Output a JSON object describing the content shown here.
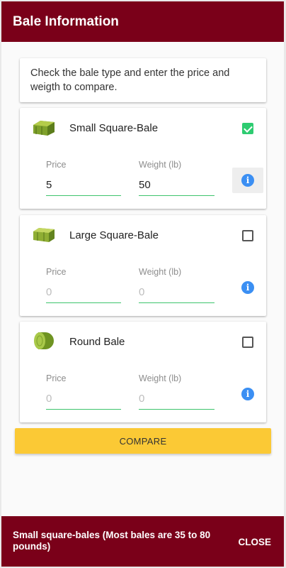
{
  "header": {
    "title": "Bale Information"
  },
  "intro": {
    "text": "Check the bale type and enter the price and weigth to compare."
  },
  "bales": [
    {
      "name": "Small Square-Bale",
      "checked": true,
      "price_label": "Price",
      "weight_label": "Weight (lb)",
      "price": "5",
      "weight": "50",
      "icon": "hay-bale-small-icon"
    },
    {
      "name": "Large Square-Bale",
      "checked": false,
      "price_label": "Price",
      "weight_label": "Weight (lb)",
      "price": "0",
      "weight": "0",
      "icon": "hay-bale-large-icon"
    },
    {
      "name": "Round Bale",
      "checked": false,
      "price_label": "Price",
      "weight_label": "Weight (lb)",
      "price": "0",
      "weight": "0",
      "icon": "round-bale-icon"
    }
  ],
  "info_icon": "i",
  "compare_button": {
    "label": "COMPARE"
  },
  "snackbar": {
    "message": "Small square-bales (Most bales are 35 to 80 pounds)",
    "action": "CLOSE"
  },
  "colors": {
    "primary": "#7a0019",
    "accent": "#fbc935",
    "check": "#2ecc71",
    "info": "#3b8ff3",
    "underline": "#3ec46d"
  }
}
